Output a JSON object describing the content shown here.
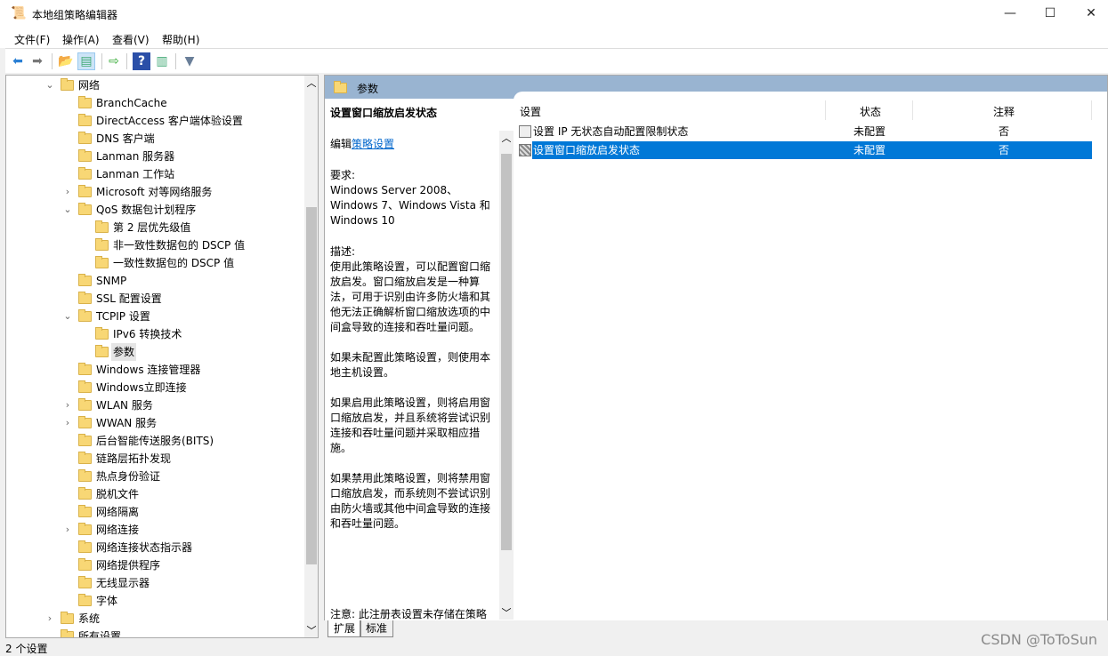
{
  "window": {
    "title": "本地组策略编辑器",
    "minimize": "—",
    "maximize": "☐",
    "close": "✕"
  },
  "menu": [
    "文件(F)",
    "操作(A)",
    "查看(V)",
    "帮助(H)"
  ],
  "toolbar": [
    "back-icon",
    "forward-icon",
    "up-folder-icon",
    "show-hide-tree-icon",
    "export-list-icon",
    "help-icon",
    "show-action-pane-icon",
    "filter-icon"
  ],
  "tree": [
    {
      "label": "网络",
      "level": 0,
      "toggle": "expanded"
    },
    {
      "label": "BranchCache",
      "level": 1
    },
    {
      "label": "DirectAccess 客户端体验设置",
      "level": 1
    },
    {
      "label": "DNS 客户端",
      "level": 1
    },
    {
      "label": "Lanman 服务器",
      "level": 1
    },
    {
      "label": "Lanman 工作站",
      "level": 1
    },
    {
      "label": "Microsoft 对等网络服务",
      "level": 1,
      "toggle": "collapsed"
    },
    {
      "label": "QoS 数据包计划程序",
      "level": 1,
      "toggle": "expanded"
    },
    {
      "label": "第 2 层优先级值",
      "level": 2
    },
    {
      "label": "非一致性数据包的 DSCP 值",
      "level": 2
    },
    {
      "label": "一致性数据包的 DSCP 值",
      "level": 2
    },
    {
      "label": "SNMP",
      "level": 1
    },
    {
      "label": "SSL 配置设置",
      "level": 1
    },
    {
      "label": "TCPIP 设置",
      "level": 1,
      "toggle": "expanded"
    },
    {
      "label": "IPv6 转换技术",
      "level": 2
    },
    {
      "label": "参数",
      "level": 2,
      "selected": true
    },
    {
      "label": "Windows 连接管理器",
      "level": 1
    },
    {
      "label": "Windows立即连接",
      "level": 1
    },
    {
      "label": "WLAN 服务",
      "level": 1,
      "toggle": "collapsed"
    },
    {
      "label": "WWAN 服务",
      "level": 1,
      "toggle": "collapsed"
    },
    {
      "label": "后台智能传送服务(BITS)",
      "level": 1
    },
    {
      "label": "链路层拓扑发现",
      "level": 1
    },
    {
      "label": "热点身份验证",
      "level": 1
    },
    {
      "label": "脱机文件",
      "level": 1
    },
    {
      "label": "网络隔离",
      "level": 1
    },
    {
      "label": "网络连接",
      "level": 1,
      "toggle": "collapsed"
    },
    {
      "label": "网络连接状态指示器",
      "level": 1
    },
    {
      "label": "网络提供程序",
      "level": 1
    },
    {
      "label": "无线显示器",
      "level": 1
    },
    {
      "label": "字体",
      "level": 1
    },
    {
      "label": "系统",
      "level": 0,
      "toggle": "collapsed"
    },
    {
      "label": "所有设置",
      "level": 0
    }
  ],
  "header": {
    "title": "参数"
  },
  "description": {
    "title": "设置窗口缩放启发状态",
    "edit_prefix": "编辑",
    "edit_link": "策略设置",
    "requirements_label": "要求:",
    "requirements": "Windows Server 2008、Windows 7、Windows Vista 和 Windows 10",
    "desc_label": "描述:",
    "desc1": "使用此策略设置，可以配置窗口缩放启发。窗口缩放启发是一种算法，可用于识别由许多防火墙和其他无法正确解析窗口缩放选项的中间盒导致的连接和吞吐量问题。",
    "desc2": "如果未配置此策略设置，则使用本地主机设置。",
    "desc3": "如果启用此策略设置，则将启用窗口缩放启发，并且系统将尝试识别连接和吞吐量问题并采取相应措施。",
    "desc4": "如果禁用此策略设置，则将禁用窗口缩放启发，而系统则不尝试识别由防火墙或其他中间盒导致的连接和吞吐量问题。",
    "note": "注意: 此注册表设置未存储在策略"
  },
  "list": {
    "columns": [
      "设置",
      "状态",
      "注释"
    ],
    "rows": [
      {
        "setting": "设置 IP 无状态自动配置限制状态",
        "state": "未配置",
        "comment": "否"
      },
      {
        "setting": "设置窗口缩放启发状态",
        "state": "未配置",
        "comment": "否",
        "selected": true
      }
    ]
  },
  "tabs": [
    "扩展",
    "标准"
  ],
  "status": "2 个设置",
  "watermark": "CSDN @ToToSun",
  "colors": {
    "selection": "#0078d7",
    "header_band": "#99b4d1",
    "link": "#0066cc"
  }
}
